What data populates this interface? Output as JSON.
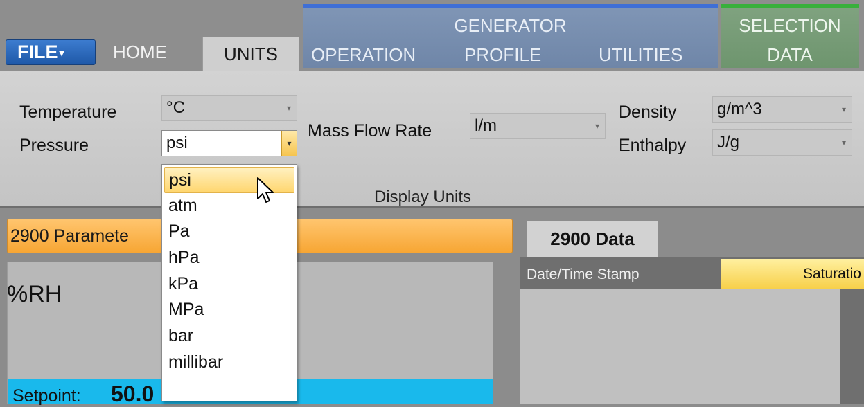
{
  "ribbon_tabs": {
    "file": "FILE",
    "home": "HOME",
    "units": "UNITS",
    "generator_group": "GENERATOR",
    "generator_tabs": [
      "OPERATION",
      "PROFILE",
      "UTILITIES"
    ],
    "selection_group": "SELECTION",
    "selection_tab": "DATA"
  },
  "units": {
    "temperature": {
      "label": "Temperature",
      "value": "°C"
    },
    "pressure": {
      "label": "Pressure",
      "value": "psi"
    },
    "mass_flow_rate": {
      "label": "Mass Flow Rate",
      "value": "l/m"
    },
    "density": {
      "label": "Density",
      "value": "g/m^3"
    },
    "enthalpy": {
      "label": "Enthalpy",
      "value": "J/g"
    },
    "group_label": "Display Units"
  },
  "pressure_options": [
    "psi",
    "atm",
    "Pa",
    "hPa",
    "kPa",
    "MPa",
    "bar",
    "millibar"
  ],
  "pressure_selected_index": 0,
  "parameters": {
    "header": "2900 Paramete",
    "rh_title": "%RH",
    "setpoint_label": "Setpoint:",
    "setpoint_value": "50.0"
  },
  "data_panel": {
    "tab": "2900 Data",
    "columns": [
      "Date/Time Stamp",
      "Saturatio"
    ]
  },
  "colors": {
    "file_button": "#2a67bb",
    "generator_accent": "#3f6fd6",
    "selection_accent": "#39b03c",
    "params_header": "#f7a634",
    "setpoint_bar": "#19b9ec",
    "highlight": "#ffd66e"
  }
}
